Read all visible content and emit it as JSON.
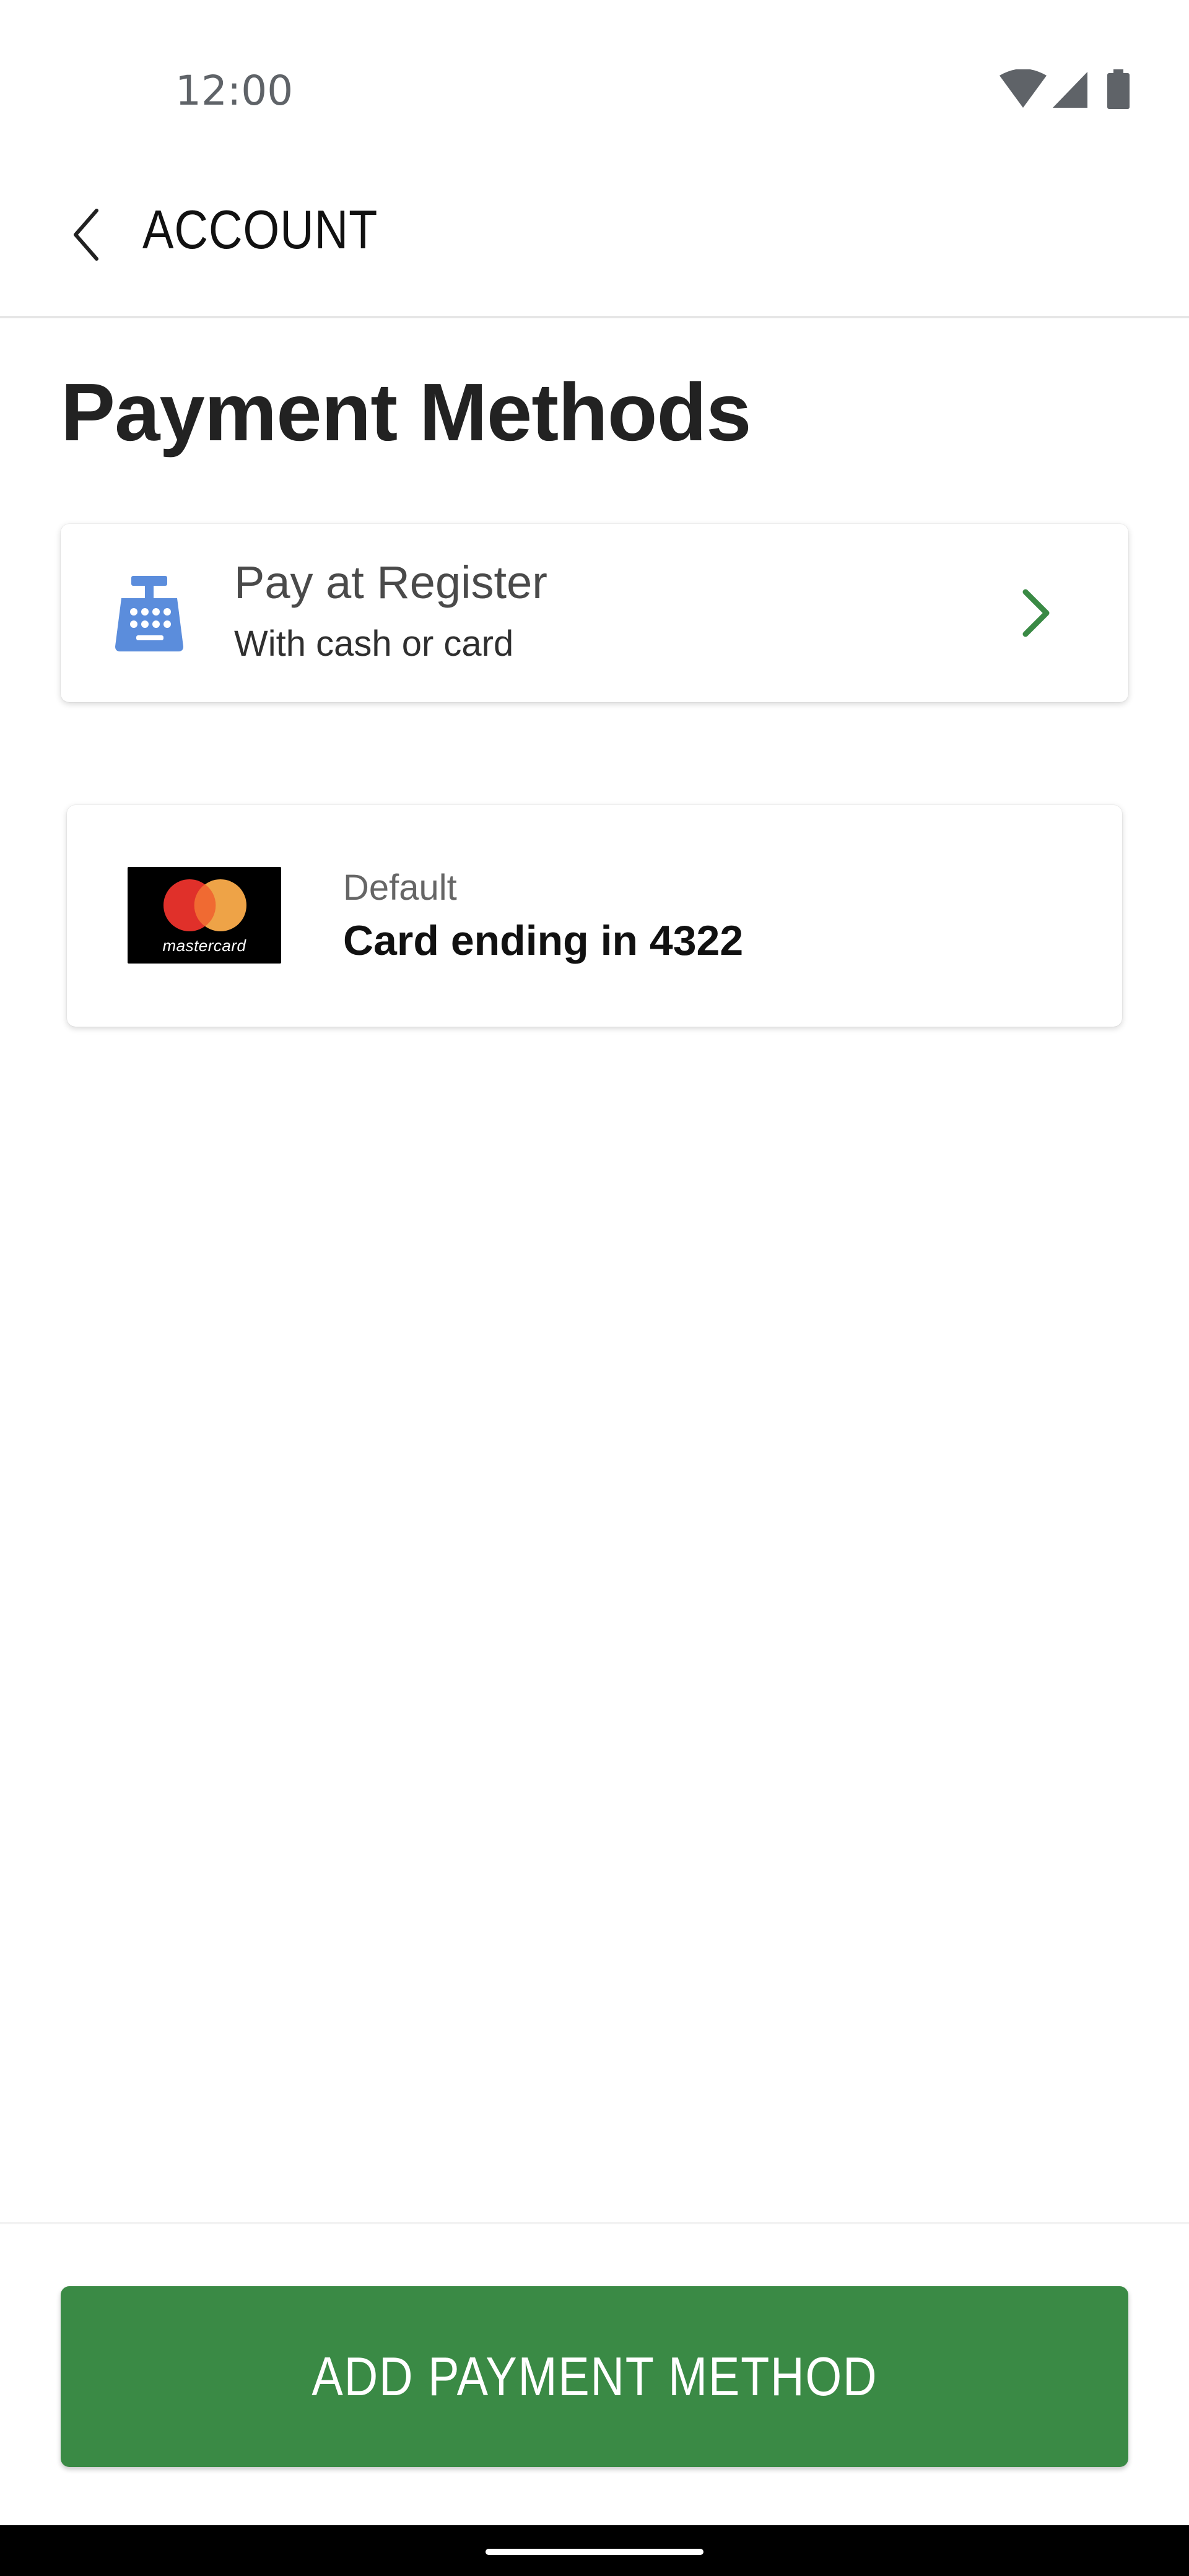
{
  "status_bar": {
    "time": "12:00",
    "icons": [
      "wifi-icon",
      "cellular-signal-icon",
      "battery-icon"
    ]
  },
  "app_bar": {
    "back_icon": "chevron-left-icon",
    "title": "ACCOUNT"
  },
  "main": {
    "title": "Payment Methods",
    "pay_at_register": {
      "icon": "cash-register-icon",
      "title": "Pay at Register",
      "subtitle": "With cash or card",
      "chevron_icon": "chevron-right-icon"
    },
    "saved_card": {
      "brand": "mastercard",
      "brand_logo_text": "mastercard",
      "default_label": "Default",
      "label": "Card ending in 4322"
    }
  },
  "footer": {
    "add_button_label": "ADD PAYMENT METHOD"
  },
  "colors": {
    "primary_green": "#3a8a45",
    "chevron_green": "#3a8a45",
    "register_icon_blue": "#5b8ddc",
    "mastercard_red": "#e0302a",
    "mastercard_orange": "#eea347"
  }
}
